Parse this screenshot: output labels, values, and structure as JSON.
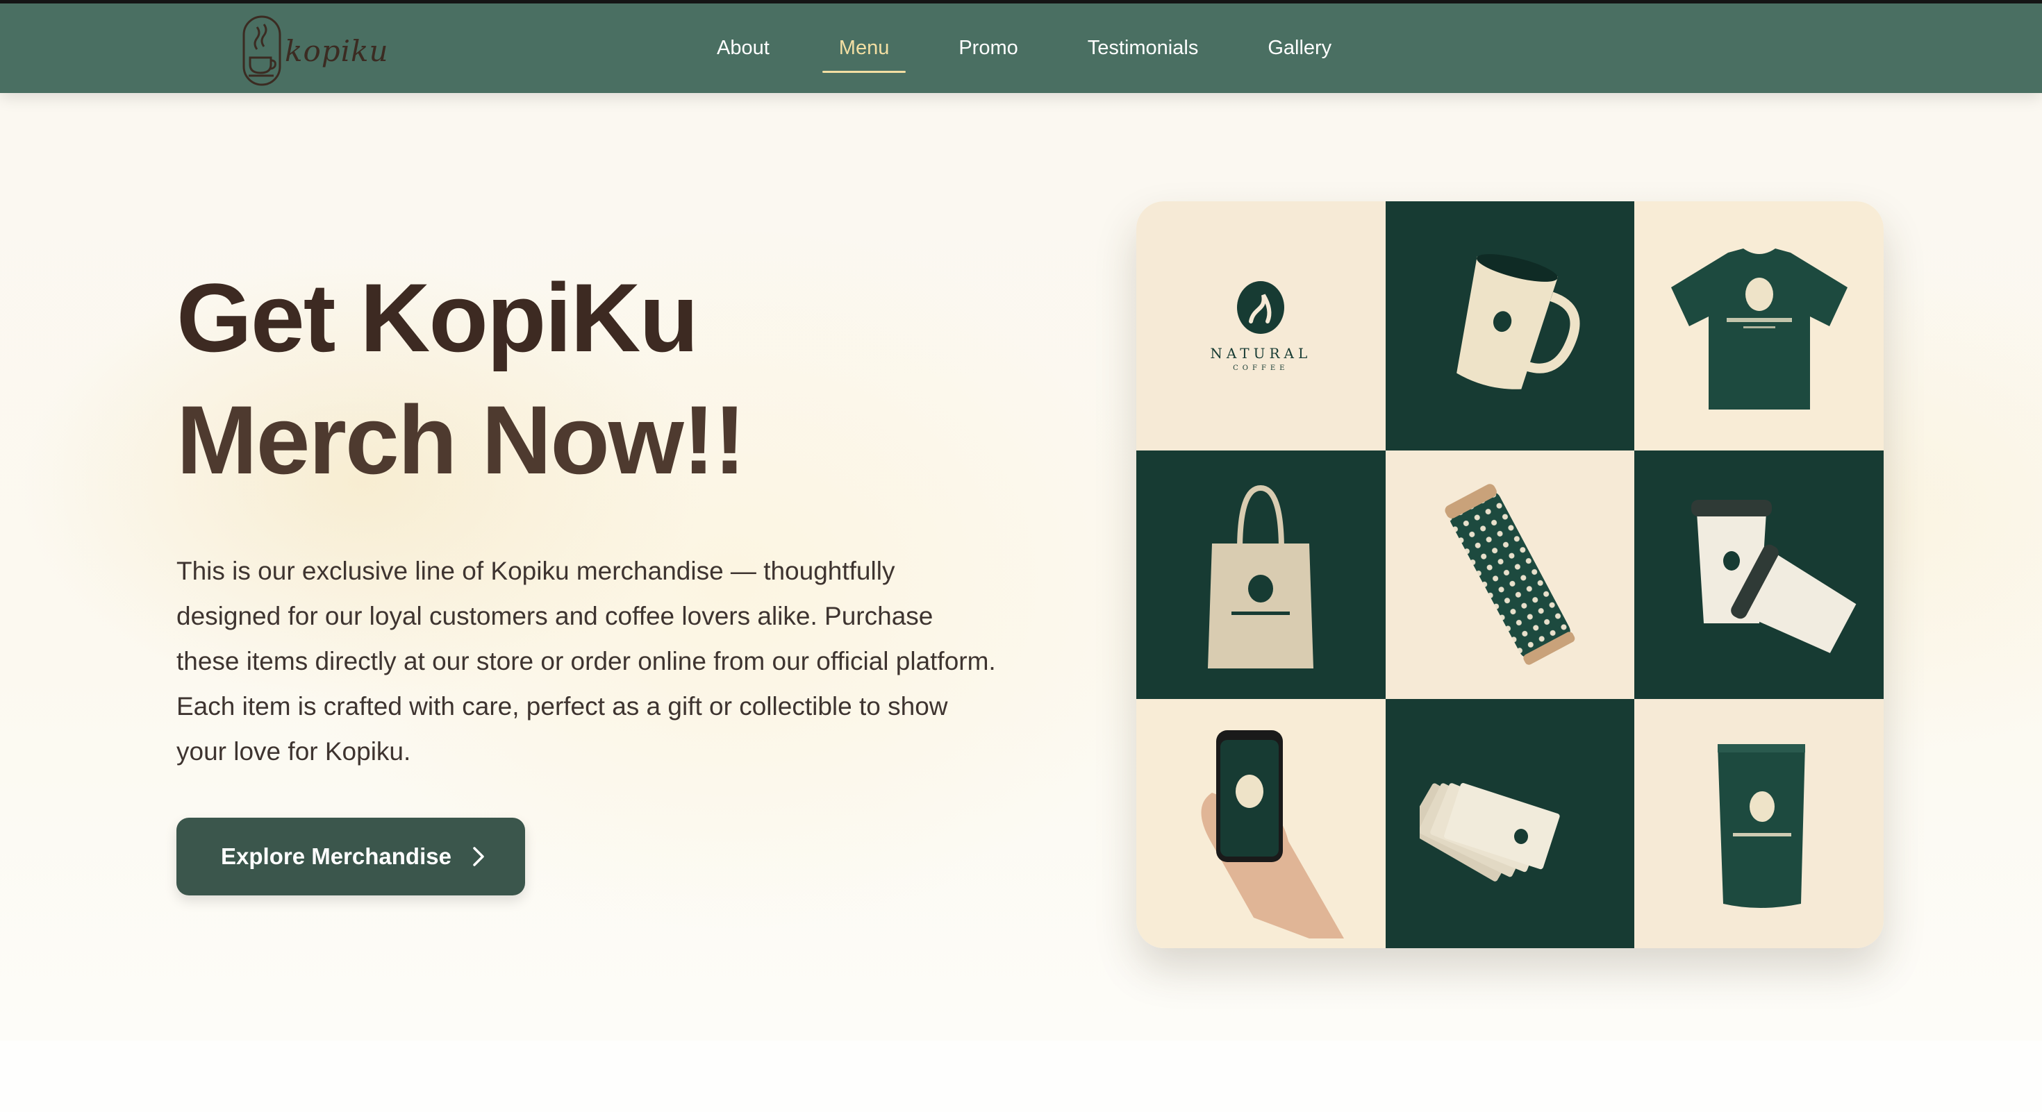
{
  "brand": {
    "name": "kopiku"
  },
  "nav": {
    "items": [
      {
        "label": "About",
        "active": false
      },
      {
        "label": "Menu",
        "active": true
      },
      {
        "label": "Promo",
        "active": false
      },
      {
        "label": "Testimonials",
        "active": false
      },
      {
        "label": "Gallery",
        "active": false
      }
    ]
  },
  "hero": {
    "title_line1": "Get KopiKu",
    "title_line2": "Merch Now!!",
    "description": "This is our exclusive line of Kopiku merchandise — thoughtfully designed for our loyal customers and coffee lovers alike. Purchase these items directly at our store or order online from our official platform. Each item is crafted with care, perfect as a gift or collectible to show your love for Kopiku.",
    "cta_label": "Explore Merchandise",
    "cta_icon": "chevron-right-icon"
  },
  "merch_grid": {
    "brand_word": "NATURAL",
    "brand_sub": "COFFEE",
    "items": [
      "logo-card",
      "mug",
      "t-shirt",
      "tote-bag",
      "tumbler",
      "paper-cups",
      "phone",
      "business-cards",
      "coffee-pouch"
    ]
  },
  "colors": {
    "nav_bg": "#4a6f62",
    "nav_active": "#f3dfa3",
    "headline": "#3d2a22",
    "cta_bg": "#3b564c",
    "brand_dark": "#173b33",
    "brand_cream": "#f6ead6"
  }
}
